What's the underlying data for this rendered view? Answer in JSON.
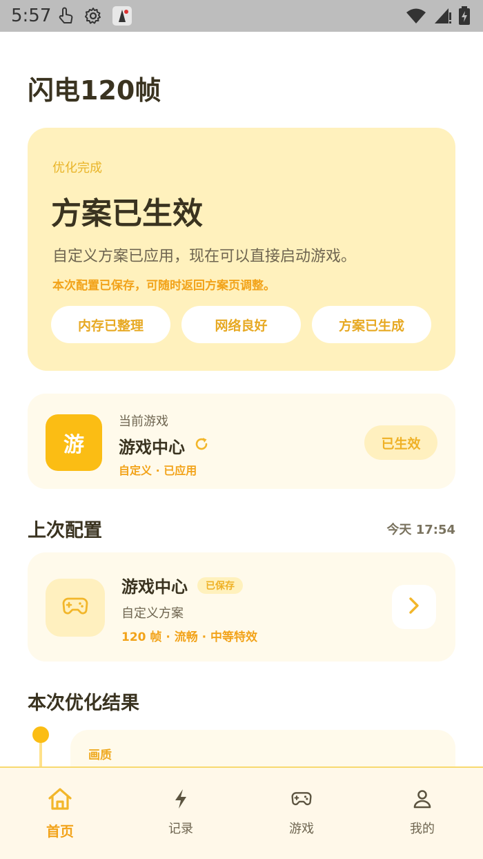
{
  "status_bar": {
    "time": "5:57",
    "left_icons": [
      "touch-icon",
      "gear-icon",
      "app-notice-icon"
    ],
    "right_icons": [
      "wifi-icon",
      "cellular-icon",
      "battery-icon"
    ]
  },
  "app": {
    "title": "闪电120帧"
  },
  "hero": {
    "kicker": "优化完成",
    "title": "方案已生效",
    "description": "自定义方案已应用，现在可以直接启动游戏。",
    "note": "本次配置已保存，可随时返回方案页调整。",
    "chips": [
      "内存已整理",
      "网络良好",
      "方案已生成"
    ]
  },
  "current_game": {
    "icon_text": "游",
    "label": "当前游戏",
    "name": "游戏中心",
    "meta": "自定义 · 已应用",
    "status": "已生效"
  },
  "last_config": {
    "section_title": "上次配置",
    "time": "今天 17:54",
    "name": "游戏中心",
    "badge": "已保存",
    "scheme": "自定义方案",
    "specs": "120 帧 · 流畅 · 中等特效"
  },
  "results": {
    "section_title": "本次优化结果",
    "first_item_label": "画质"
  },
  "bottom_nav": {
    "items": [
      {
        "label": "首页",
        "icon": "home-icon",
        "active": true
      },
      {
        "label": "记录",
        "icon": "lightning-icon",
        "active": false
      },
      {
        "label": "游戏",
        "icon": "gamepad-icon",
        "active": false
      },
      {
        "label": "我的",
        "icon": "user-icon",
        "active": false
      }
    ]
  },
  "colors": {
    "accent": "#fbbd14",
    "accent_text": "#f2a31a",
    "hero_bg": "#fff1bd",
    "card_bg": "#fffaeb",
    "text_dark": "#3a3320",
    "text_muted": "#6e6550"
  }
}
